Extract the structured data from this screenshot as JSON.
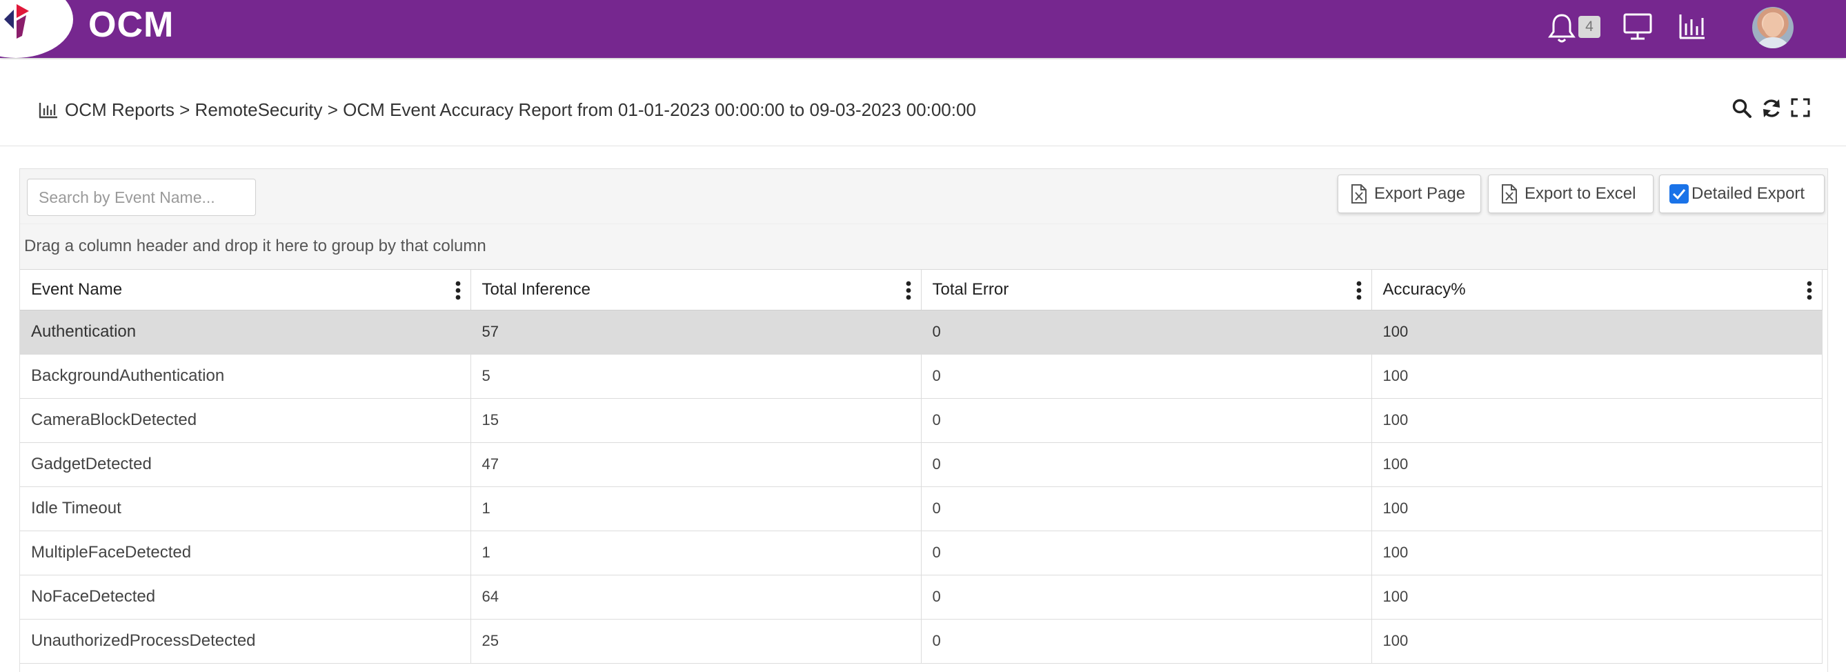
{
  "app": {
    "brand": "OCM",
    "notification_count": "4",
    "colors": {
      "header": "#76278f",
      "accent": "#1a73e8"
    }
  },
  "breadcrumb": {
    "icon": "bar-chart-icon",
    "text": "OCM Reports > RemoteSecurity > OCM Event Accuracy Report from 01-01-2023 00:00:00 to 09-03-2023 00:00:00"
  },
  "toolbar": {
    "search_placeholder": "Search by Event Name...",
    "export_page_label": "Export Page",
    "export_excel_label": "Export to Excel",
    "detailed_export_label": "Detailed Export",
    "detailed_export_checked": true
  },
  "grid": {
    "group_hint": "Drag a column header and drop it here to group by that column",
    "columns": [
      "Event Name",
      "Total Inference",
      "Total Error",
      "Accuracy%"
    ],
    "rows": [
      [
        "Authentication",
        "57",
        "0",
        "100"
      ],
      [
        "BackgroundAuthentication",
        "5",
        "0",
        "100"
      ],
      [
        "CameraBlockDetected",
        "15",
        "0",
        "100"
      ],
      [
        "GadgetDetected",
        "47",
        "0",
        "100"
      ],
      [
        "Idle Timeout",
        "1",
        "0",
        "100"
      ],
      [
        "MultipleFaceDetected",
        "1",
        "0",
        "100"
      ],
      [
        "NoFaceDetected",
        "64",
        "0",
        "100"
      ],
      [
        "UnauthorizedProcessDetected",
        "25",
        "0",
        "100"
      ]
    ]
  }
}
